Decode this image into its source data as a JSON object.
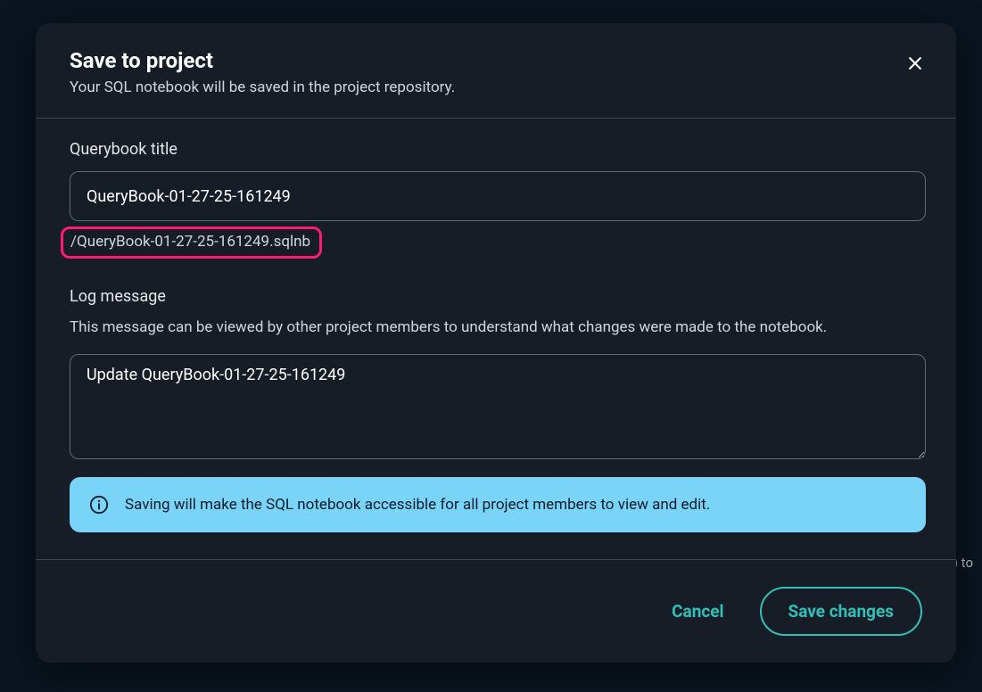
{
  "backdrop_fragment": ") to",
  "modal": {
    "title": "Save to project",
    "subtitle": "Your SQL notebook will be saved in the project repository."
  },
  "querybook": {
    "label": "Querybook title",
    "value": "QueryBook-01-27-25-161249",
    "file_path": "/QueryBook-01-27-25-161249.sqlnb"
  },
  "log": {
    "label": "Log message",
    "description": "This message can be viewed by other project members to understand what changes were made to the notebook.",
    "value": "Update QueryBook-01-27-25-161249"
  },
  "info": {
    "text": "Saving will make the SQL notebook accessible for all project members to view and edit."
  },
  "footer": {
    "cancel": "Cancel",
    "save": "Save changes"
  }
}
